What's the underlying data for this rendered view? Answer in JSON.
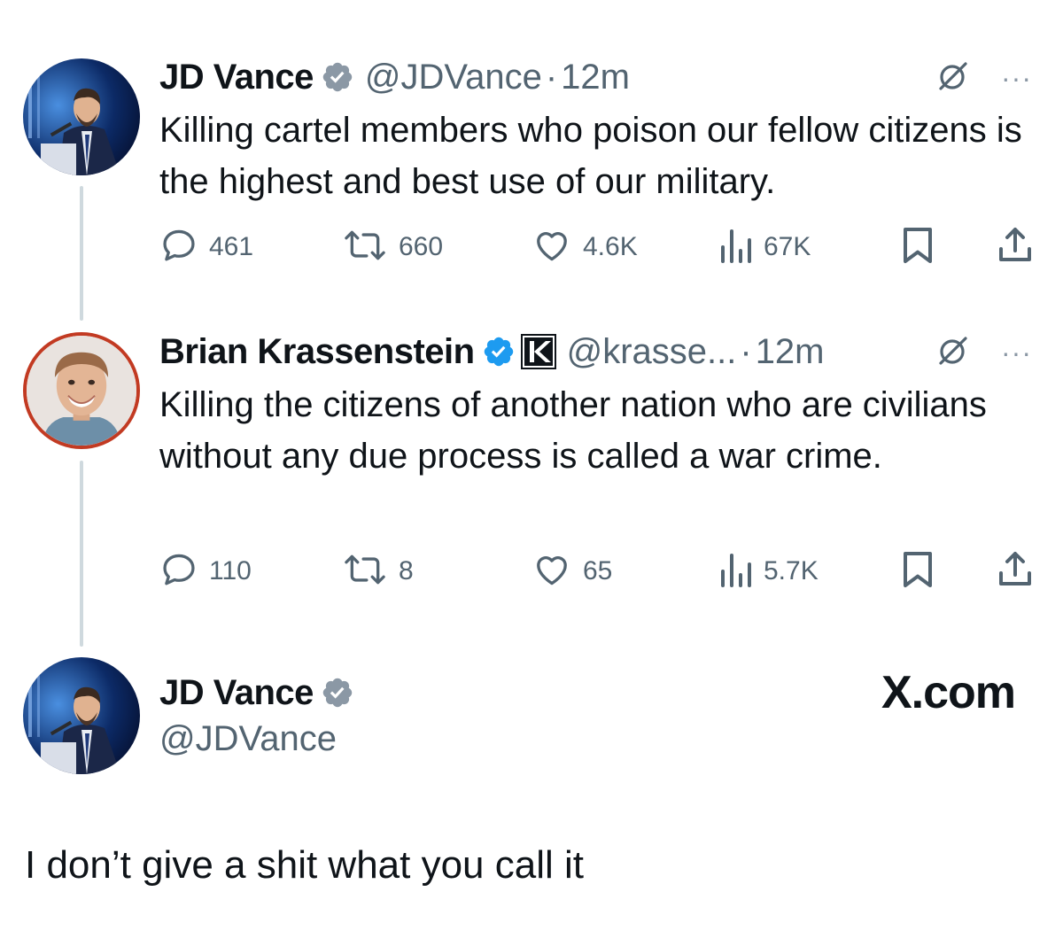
{
  "tweets": [
    {
      "name": "JD Vance",
      "handle": "@JDVance",
      "separator": "·",
      "time": "12m",
      "text": "Killing cartel members who poison our fellow citizens is the highest and best use of our military.",
      "stats": {
        "replies": "461",
        "reposts": "660",
        "likes": "4.6K",
        "views": "67K"
      }
    },
    {
      "name": "Brian Krassenstein",
      "handle": "@krasse...",
      "separator": "·",
      "time": "12m",
      "text": "Killing the citizens of another nation who are civilians without any due process is called a war crime.",
      "stats": {
        "replies": "110",
        "reposts": "8",
        "likes": "65",
        "views": "5.7K"
      }
    }
  ],
  "reply_card": {
    "name": "JD Vance",
    "handle": "@JDVance",
    "site_logo": "X.com",
    "text": "I don’t give a shit what you call it"
  },
  "more_label": "···",
  "colors": {
    "verified_gold": "#8b98a5",
    "verified_blue": "#1d9bf0",
    "secondary_text": "#536471",
    "thread_line": "#cfd9de"
  },
  "icons": [
    "verified-badge-icon",
    "k-affiliate-icon",
    "grok-icon",
    "more-icon",
    "reply-icon",
    "repost-icon",
    "like-icon",
    "views-icon",
    "bookmark-icon",
    "share-icon"
  ]
}
